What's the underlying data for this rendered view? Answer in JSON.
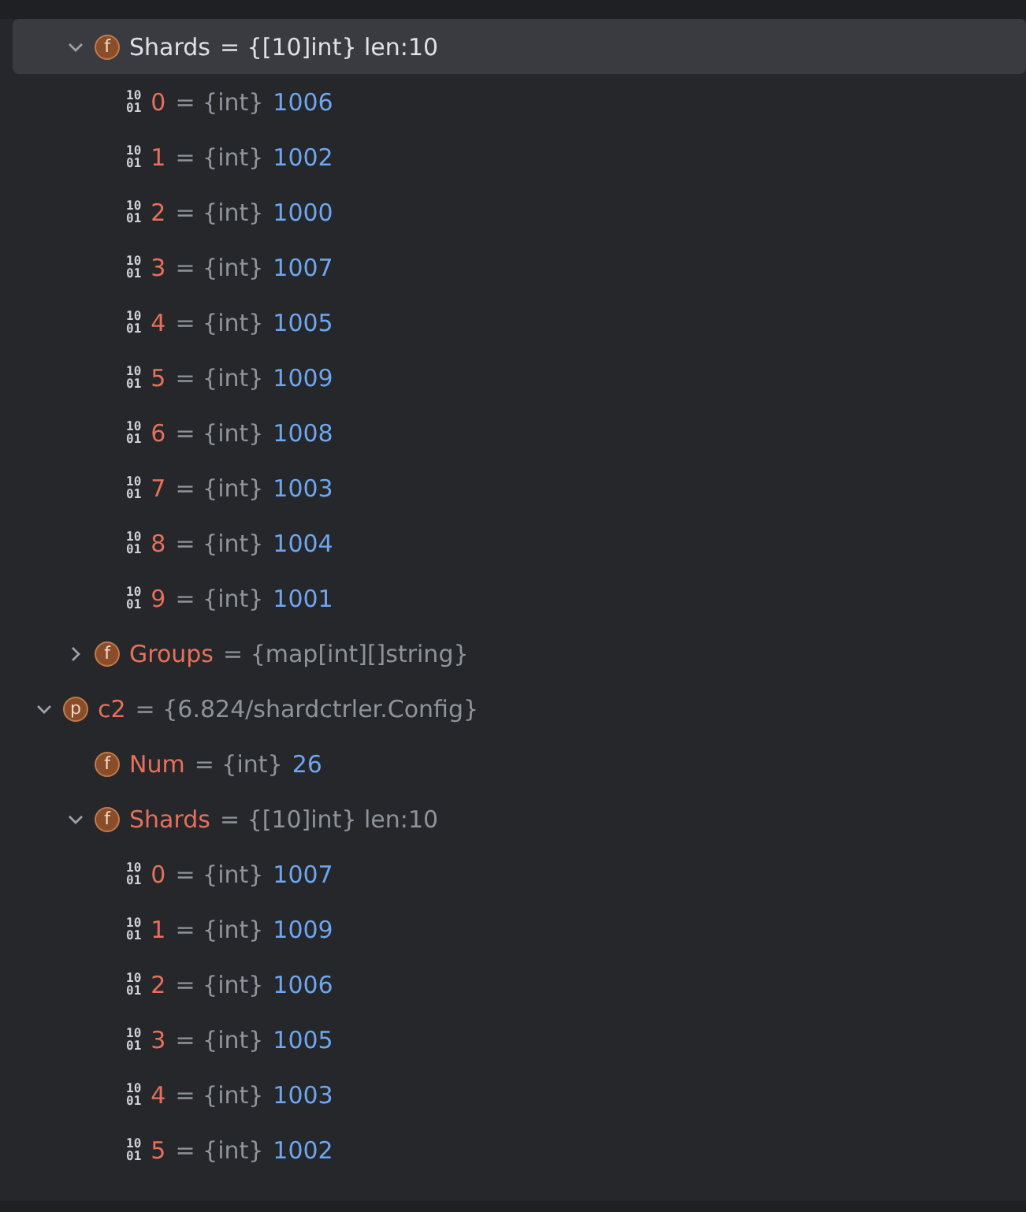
{
  "tree": [
    {
      "kind": "group",
      "children": [
        {
          "kind": "field",
          "badge": "f",
          "name": "Shards",
          "type": "= {[10]int} len:10",
          "expanded": true,
          "selected": true,
          "children": [
            {
              "kind": "bits",
              "badge": [
                "10",
                "01"
              ],
              "name": "0",
              "type": "= {int}",
              "value": "1006",
              "selected": false
            },
            {
              "kind": "bits",
              "badge": [
                "10",
                "01"
              ],
              "name": "1",
              "type": "= {int}",
              "value": "1002",
              "selected": false
            },
            {
              "kind": "bits",
              "badge": [
                "10",
                "01"
              ],
              "name": "2",
              "type": "= {int}",
              "value": "1000",
              "selected": false
            },
            {
              "kind": "bits",
              "badge": [
                "10",
                "01"
              ],
              "name": "3",
              "type": "= {int}",
              "value": "1007",
              "selected": false
            },
            {
              "kind": "bits",
              "badge": [
                "10",
                "01"
              ],
              "name": "4",
              "type": "= {int}",
              "value": "1005",
              "selected": false
            },
            {
              "kind": "bits",
              "badge": [
                "10",
                "01"
              ],
              "name": "5",
              "type": "= {int}",
              "value": "1009",
              "selected": false
            },
            {
              "kind": "bits",
              "badge": [
                "10",
                "01"
              ],
              "name": "6",
              "type": "= {int}",
              "value": "1008",
              "selected": false
            },
            {
              "kind": "bits",
              "badge": [
                "10",
                "01"
              ],
              "name": "7",
              "type": "= {int}",
              "value": "1003",
              "selected": false
            },
            {
              "kind": "bits",
              "badge": [
                "10",
                "01"
              ],
              "name": "8",
              "type": "= {int}",
              "value": "1004",
              "selected": false
            },
            {
              "kind": "bits",
              "badge": [
                "10",
                "01"
              ],
              "name": "9",
              "type": "= {int}",
              "value": "1001",
              "selected": false
            }
          ]
        },
        {
          "kind": "field",
          "badge": "f",
          "name": "Groups",
          "type": "= {map[int][]string}",
          "expanded": false,
          "selected": false
        }
      ]
    },
    {
      "kind": "field",
      "badge": "p",
      "name": "c2",
      "type": "= {6.824/shardctrler.Config}",
      "expanded": true,
      "selected": false,
      "children": [
        {
          "kind": "field",
          "badge": "f",
          "name": "Num",
          "type": "= {int}",
          "value": "26",
          "selected": false
        },
        {
          "kind": "field",
          "badge": "f",
          "name": "Shards",
          "type": "= {[10]int} len:10",
          "expanded": true,
          "selected": false,
          "children": [
            {
              "kind": "bits",
              "badge": [
                "10",
                "01"
              ],
              "name": "0",
              "type": "= {int}",
              "value": "1007",
              "selected": false
            },
            {
              "kind": "bits",
              "badge": [
                "10",
                "01"
              ],
              "name": "1",
              "type": "= {int}",
              "value": "1009",
              "selected": false
            },
            {
              "kind": "bits",
              "badge": [
                "10",
                "01"
              ],
              "name": "2",
              "type": "= {int}",
              "value": "1006",
              "selected": false
            },
            {
              "kind": "bits",
              "badge": [
                "10",
                "01"
              ],
              "name": "3",
              "type": "= {int}",
              "value": "1005",
              "selected": false
            },
            {
              "kind": "bits",
              "badge": [
                "10",
                "01"
              ],
              "name": "4",
              "type": "= {int}",
              "value": "1003",
              "selected": false
            },
            {
              "kind": "bits",
              "badge": [
                "10",
                "01"
              ],
              "name": "5",
              "type": "= {int}",
              "value": "1002",
              "selected": false
            }
          ]
        }
      ]
    }
  ]
}
